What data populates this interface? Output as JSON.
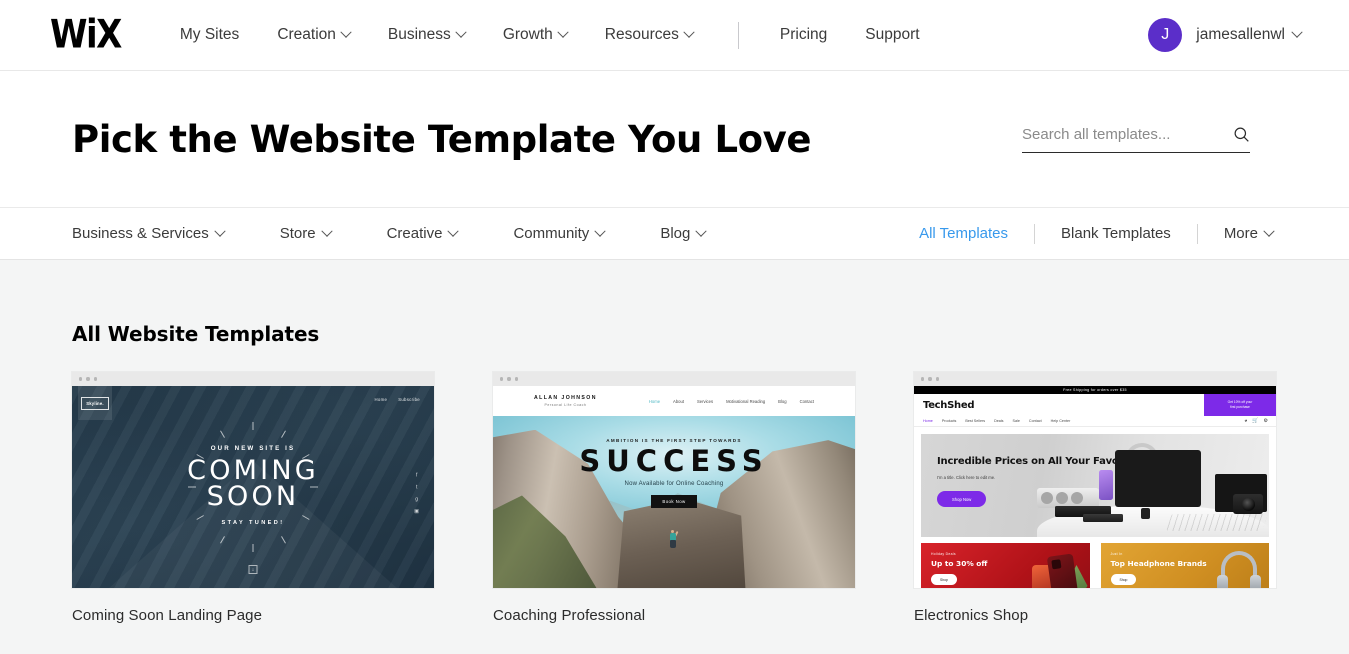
{
  "header": {
    "logo": "WiX",
    "nav": [
      {
        "label": "My Sites",
        "has_caret": false
      },
      {
        "label": "Creation",
        "has_caret": true
      },
      {
        "label": "Business",
        "has_caret": true
      },
      {
        "label": "Growth",
        "has_caret": true
      },
      {
        "label": "Resources",
        "has_caret": true
      }
    ],
    "nav_right": [
      {
        "label": "Pricing"
      },
      {
        "label": "Support"
      }
    ],
    "account": {
      "avatar_initial": "J",
      "avatar_color": "#5b2ec9",
      "username": "jamesallenwl"
    }
  },
  "hero": {
    "title": "Pick the Website Template You Love",
    "search_placeholder": "Search all templates...",
    "search_value": "",
    "search_icon": "search-icon"
  },
  "categories": {
    "left": [
      {
        "label": "Business & Services",
        "has_caret": true
      },
      {
        "label": "Store",
        "has_caret": true
      },
      {
        "label": "Creative",
        "has_caret": true
      },
      {
        "label": "Community",
        "has_caret": true
      },
      {
        "label": "Blog",
        "has_caret": true
      }
    ],
    "right": [
      {
        "label": "All Templates",
        "active": true,
        "has_caret": false
      },
      {
        "label": "Blank Templates",
        "active": false,
        "has_caret": false
      },
      {
        "label": "More",
        "active": false,
        "has_caret": true
      }
    ],
    "active_color": "#3899ec"
  },
  "main": {
    "section_title": "All Website Templates",
    "templates": [
      {
        "title": "Coming Soon Landing Page",
        "preview": {
          "logo": "Skyline.",
          "nav": [
            "Home",
            "Subscribe"
          ],
          "kicker": "OUR NEW SITE IS",
          "headline_line1": "COMING",
          "headline_line2": "SOON",
          "tagline": "STAY TUNED!",
          "scroll_glyph": "↓"
        }
      },
      {
        "title": "Coaching Professional",
        "preview": {
          "brand": "ALLAN JOHNSON",
          "brand_sub": "Personal Life Coach",
          "nav": [
            "Home",
            "About",
            "Services",
            "Motivational Reading",
            "Blog",
            "Contact"
          ],
          "kicker": "AMBITION IS THE FIRST STEP TOWARDS",
          "headline": "SUCCESS",
          "subline": "Now Available for Online Coaching",
          "button": "Book Now"
        }
      },
      {
        "title": "Electronics Shop",
        "preview": {
          "announcement": "Free Shipping for orders over $35",
          "brand": "TechShed",
          "promo_line1": "Get 10% off your",
          "promo_line2": "first purchase",
          "nav": [
            "Home",
            "Products",
            "Best Sellers",
            "Deals",
            "Sale",
            "Contact",
            "Help Center"
          ],
          "hero_title": "Incredible Prices on All Your Favorite Items",
          "hero_sub": "I'm a title. Click here to edit me.",
          "hero_button": "Shop Now",
          "promo_cards": [
            {
              "kicker": "Holiday Deals",
              "title": "Up to 30% off",
              "button": "Shop",
              "color": "#c8102e"
            },
            {
              "kicker": "Just In",
              "title": "Top Headphone Brands",
              "button": "Shop",
              "color": "#d9952a"
            }
          ]
        }
      }
    ]
  }
}
